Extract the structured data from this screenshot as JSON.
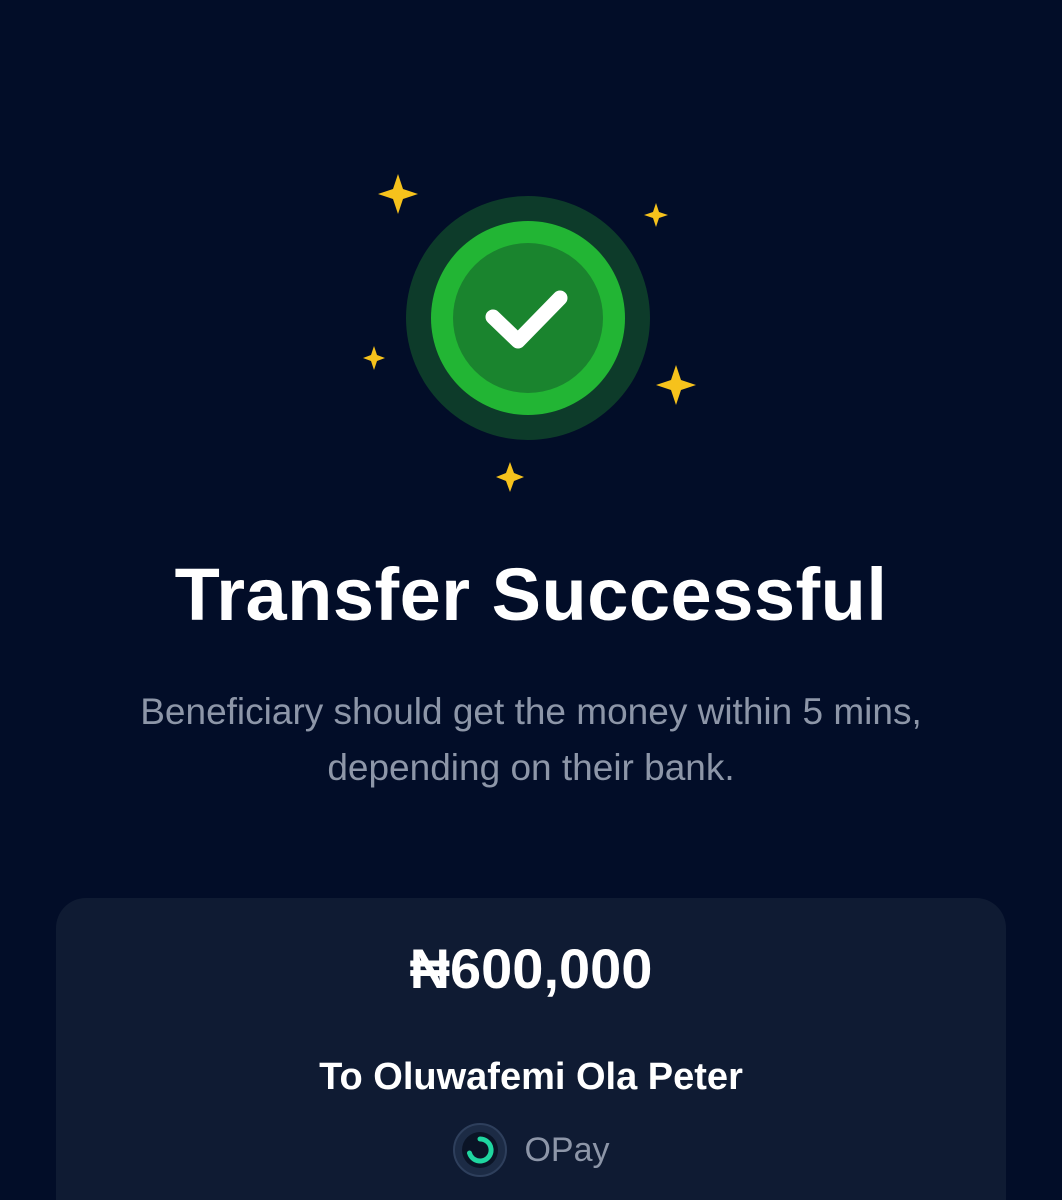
{
  "status": {
    "title": "Transfer Successful",
    "message_line1": "Beneficiary should get the money within 5 mins,",
    "message_line2": "depending on their bank."
  },
  "summary": {
    "amount": "₦600,000",
    "recipient": "To Oluwafemi Ola Peter",
    "bank_name": "OPay"
  },
  "icons": {
    "status": "check-circle-icon",
    "decoration": "sparkle-icon",
    "bank": "opay-logo"
  },
  "colors": {
    "background": "#020d28",
    "card": "#0f1b33",
    "success": "#22b534",
    "sparkle": "#f6c21c"
  }
}
